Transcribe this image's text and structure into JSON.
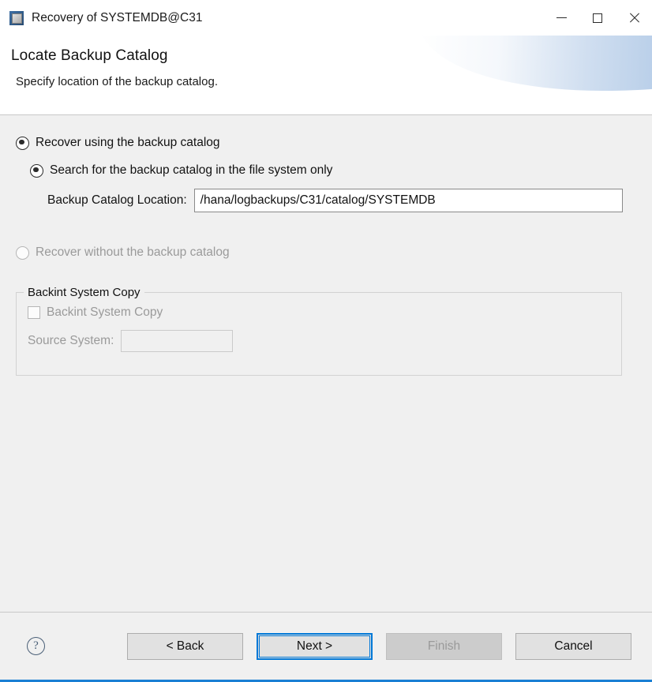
{
  "window": {
    "title": "Recovery of SYSTEMDB@C31",
    "app_icon": "hana-studio-icon",
    "controls": {
      "minimize": "minimize-icon",
      "maximize": "maximize-icon",
      "close": "close-icon"
    }
  },
  "header": {
    "title": "Locate Backup Catalog",
    "subtitle": "Specify location of the backup catalog."
  },
  "form": {
    "primary_option": {
      "label": "Recover using the backup catalog",
      "checked": true,
      "enabled": true
    },
    "secondary_option": {
      "label": "Search for the backup catalog in the file system only",
      "checked": true,
      "enabled": true
    },
    "catalog_location": {
      "label": "Backup Catalog Location:",
      "value": "/hana/logbackups/C31/catalog/SYSTEMDB",
      "placeholder": ""
    },
    "no_catalog_option": {
      "label": "Recover without the backup catalog",
      "checked": false,
      "enabled": false
    },
    "backint_group": {
      "title": "Backint System Copy",
      "checkbox_label": "Backint System Copy",
      "checkbox_checked": false,
      "source_system_label": "Source System:",
      "source_system_value": "",
      "enabled": false
    }
  },
  "footer": {
    "help_icon": "help-icon",
    "help_glyph": "?",
    "buttons": [
      {
        "label": "< Back",
        "state": "enabled"
      },
      {
        "label": "Next >",
        "state": "focused"
      },
      {
        "label": "Finish",
        "state": "disabled"
      },
      {
        "label": "Cancel",
        "state": "enabled"
      }
    ]
  },
  "colors": {
    "accent": "#0078d7",
    "bottom_border": "#1a7fd4",
    "content_bg": "#f0f0f0",
    "header_bg": "#ffffff",
    "disabled_text": "#9a9a9a"
  }
}
